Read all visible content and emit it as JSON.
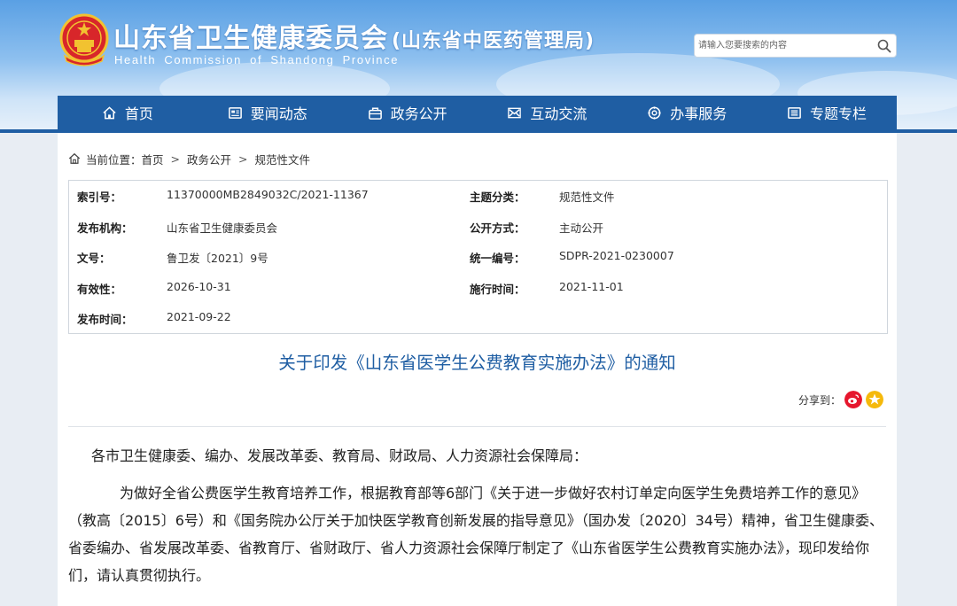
{
  "header": {
    "title": "山东省卫生健康委员会",
    "title_sub": "(山东省中医药管理局)",
    "title_en": "Health Commission of Shandong Province",
    "emblem_icon": "national-emblem-icon"
  },
  "search": {
    "placeholder": "请输入您要搜索的内容",
    "icon": "search-icon"
  },
  "nav": {
    "items": [
      {
        "label": "首页",
        "icon": "home-icon"
      },
      {
        "label": "要闻动态",
        "icon": "news-icon"
      },
      {
        "label": "政务公开",
        "icon": "gov-icon"
      },
      {
        "label": "互动交流",
        "icon": "interact-icon"
      },
      {
        "label": "办事服务",
        "icon": "service-icon"
      },
      {
        "label": "专题专栏",
        "icon": "topic-icon"
      }
    ]
  },
  "breadcrumb": {
    "label": "当前位置：",
    "items": [
      "首页",
      "政务公开",
      "规范性文件"
    ],
    "separator": ">"
  },
  "meta": {
    "index_no_label": "索引号：",
    "index_no": "11370000MB2849032C/2021-11367",
    "topic_label": "主题分类：",
    "topic": "规范性文件",
    "issuer_label": "发布机构：",
    "issuer": "山东省卫生健康委员会",
    "disclosure_label": "公开方式：",
    "disclosure": "主动公开",
    "doc_no_label": "文号：",
    "doc_no": "鲁卫发〔2021〕9号",
    "unified_no_label": "统一编号：",
    "unified_no": "SDPR-2021-0230007",
    "validity_label": "有效性：",
    "validity": "2026-10-31",
    "effective_label": "施行时间：",
    "effective": "2021-11-01",
    "publish_label": "发布时间：",
    "publish": "2021-09-22"
  },
  "article": {
    "title": "关于印发《山东省医学生公费教育实施办法》的通知",
    "share_label": "分享到：",
    "p1": "各市卫生健康委、编办、发展改革委、教育局、财政局、人力资源社会保障局：",
    "p2": "为做好全省公费医学生教育培养工作，根据教育部等6部门《关于进一步做好农村订单定向医学生免费培养工作的意见》（教高〔2015〕6号）和《国务院办公厅关于加快医学教育创新发展的指导意见》（国办发〔2020〕34号）精神，省卫生健康委、省委编办、省发展改革委、省教育厅、省财政厅、省人力资源社会保障厅制定了《山东省医学生公费教育实施办法》，现印发给你们，请认真贯彻执行。"
  },
  "colors": {
    "nav_bg": "#1f5ea3",
    "title_blue": "#1f5ea3",
    "weibo_red": "#e6162d",
    "qzone_yellow": "#f5b90b"
  }
}
